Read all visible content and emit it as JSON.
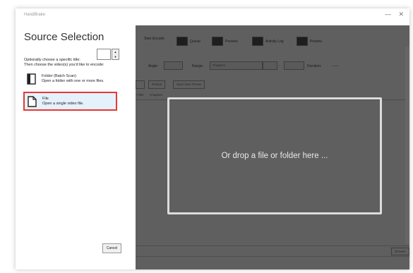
{
  "window": {
    "app_title": "HandBrake",
    "minimize_glyph": "—",
    "close_glyph": "✕"
  },
  "source_panel": {
    "title": "Source Selection",
    "title_prompt": "Optionally choose a specific title:",
    "title_value": "",
    "choose_prompt": "Then choose the video(s) you'd like to encode:",
    "folder_option": {
      "label": "Folder (Batch Scan)",
      "description": "Open a folder with one or more files.",
      "icon": "folder-icon"
    },
    "file_option": {
      "label": "File",
      "description": "Open a single video file.",
      "icon": "file-icon",
      "highlight_color": "#e53935"
    },
    "cancel_label": "Cancel"
  },
  "toolbar": {
    "items": [
      {
        "label": "Start Encode",
        "icon": "play-icon"
      },
      {
        "label": "Queue",
        "icon": "queue-icon"
      },
      {
        "label": "Preview",
        "icon": "preview-icon"
      },
      {
        "label": "Activity Log",
        "icon": "log-icon"
      },
      {
        "label": "Presets",
        "icon": "presets-icon"
      }
    ]
  },
  "source_row": {
    "angle_label": "Angle:",
    "range_label": "Range:",
    "range_value": "Chapters",
    "range_separator": "-",
    "duration_label": "Duration:",
    "duration_value": "------"
  },
  "preset_row": {
    "reload_label": "Reload",
    "save_label": "Save New Preset"
  },
  "tabs": [
    "Filter",
    "Chapters"
  ],
  "drop_zone": {
    "text": "Or drop a file or folder here ..."
  },
  "destination": {
    "browse_label": "Browse"
  },
  "colors": {
    "overlay": "#5f5f5f",
    "drop_border": "#dcdcdc",
    "selected_bg": "#e5f1fb"
  }
}
